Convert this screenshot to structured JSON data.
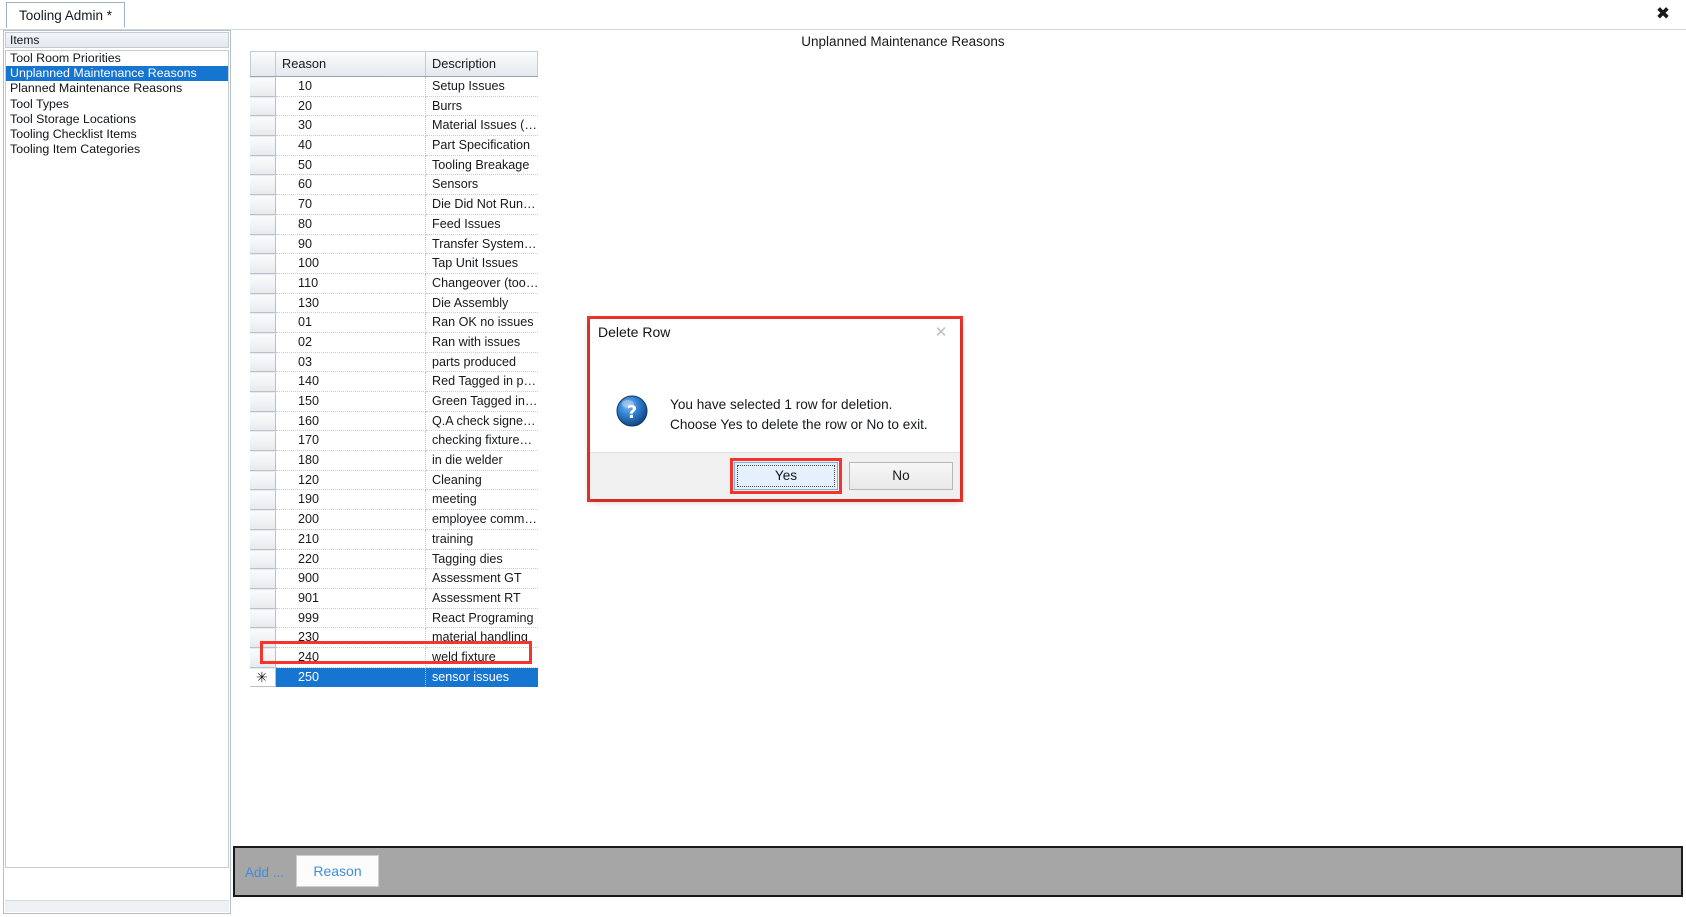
{
  "window": {
    "tab_label": "Tooling Admin *",
    "close_icon": "✖"
  },
  "sidebar": {
    "header": "Items",
    "items": [
      {
        "label": "Tool Room Priorities",
        "selected": false
      },
      {
        "label": "Unplanned Maintenance Reasons",
        "selected": true
      },
      {
        "label": "Planned Maintenance Reasons",
        "selected": false
      },
      {
        "label": "Tool Types",
        "selected": false
      },
      {
        "label": "Tool Storage Locations",
        "selected": false
      },
      {
        "label": "Tooling Checklist Items",
        "selected": false
      },
      {
        "label": "Tooling Item Categories",
        "selected": false
      }
    ]
  },
  "main": {
    "title": "Unplanned Maintenance Reasons"
  },
  "grid": {
    "columns": [
      "Reason",
      "Description"
    ],
    "new_row_glyph": "✳",
    "rows": [
      {
        "reason": "10",
        "description": "Setup Issues",
        "selected": false
      },
      {
        "reason": "20",
        "description": "Burrs",
        "selected": false
      },
      {
        "reason": "30",
        "description": "Material Issues (…",
        "selected": false
      },
      {
        "reason": "40",
        "description": "Part Specification",
        "selected": false
      },
      {
        "reason": "50",
        "description": "Tooling Breakage",
        "selected": false
      },
      {
        "reason": "60",
        "description": "Sensors",
        "selected": false
      },
      {
        "reason": "70",
        "description": "Die Did Not Run…",
        "selected": false
      },
      {
        "reason": "80",
        "description": "Feed Issues",
        "selected": false
      },
      {
        "reason": "90",
        "description": "Transfer System…",
        "selected": false
      },
      {
        "reason": "100",
        "description": "Tap Unit Issues",
        "selected": false
      },
      {
        "reason": "110",
        "description": "Changeover  (too…",
        "selected": false
      },
      {
        "reason": "130",
        "description": "Die Assembly",
        "selected": false
      },
      {
        "reason": "01",
        "description": "Ran OK no issues",
        "selected": false
      },
      {
        "reason": "02",
        "description": "Ran with issues",
        "selected": false
      },
      {
        "reason": "03",
        "description": "parts produced",
        "selected": false
      },
      {
        "reason": "140",
        "description": "Red Tagged in p…",
        "selected": false
      },
      {
        "reason": "150",
        "description": "Green Tagged in…",
        "selected": false
      },
      {
        "reason": "160",
        "description": "Q.A check signe…",
        "selected": false
      },
      {
        "reason": "170",
        "description": "checking fixture…",
        "selected": false
      },
      {
        "reason": "180",
        "description": "in die welder",
        "selected": false
      },
      {
        "reason": "120",
        "description": "Cleaning",
        "selected": false
      },
      {
        "reason": "190",
        "description": "meeting",
        "selected": false
      },
      {
        "reason": "200",
        "description": "employee  comm…",
        "selected": false
      },
      {
        "reason": "210",
        "description": "training",
        "selected": false
      },
      {
        "reason": "220",
        "description": "Tagging dies",
        "selected": false
      },
      {
        "reason": "900",
        "description": "Assessment GT",
        "selected": false
      },
      {
        "reason": "901",
        "description": "Assessment RT",
        "selected": false
      },
      {
        "reason": "999",
        "description": "React Programing",
        "selected": false
      },
      {
        "reason": "230",
        "description": "material handling",
        "selected": false
      },
      {
        "reason": "240",
        "description": "weld fixture",
        "selected": false
      },
      {
        "reason": "250",
        "description": "sensor issues",
        "selected": true
      }
    ]
  },
  "toolbar": {
    "add_label": "Add ...",
    "reason_button": "Reason"
  },
  "dialog": {
    "title": "Delete Row",
    "close_icon": "✕",
    "icon_name": "question-icon",
    "message_line1": "You have selected 1 row for deletion.",
    "message_line2": "Choose Yes to delete the row or No to exit.",
    "yes_label": "Yes",
    "no_label": "No"
  },
  "colors": {
    "selection_blue": "#1675d1",
    "highlight_red": "#f5352b",
    "toolbar_gray": "#a6a6a6",
    "link_blue": "#3e8ede"
  }
}
